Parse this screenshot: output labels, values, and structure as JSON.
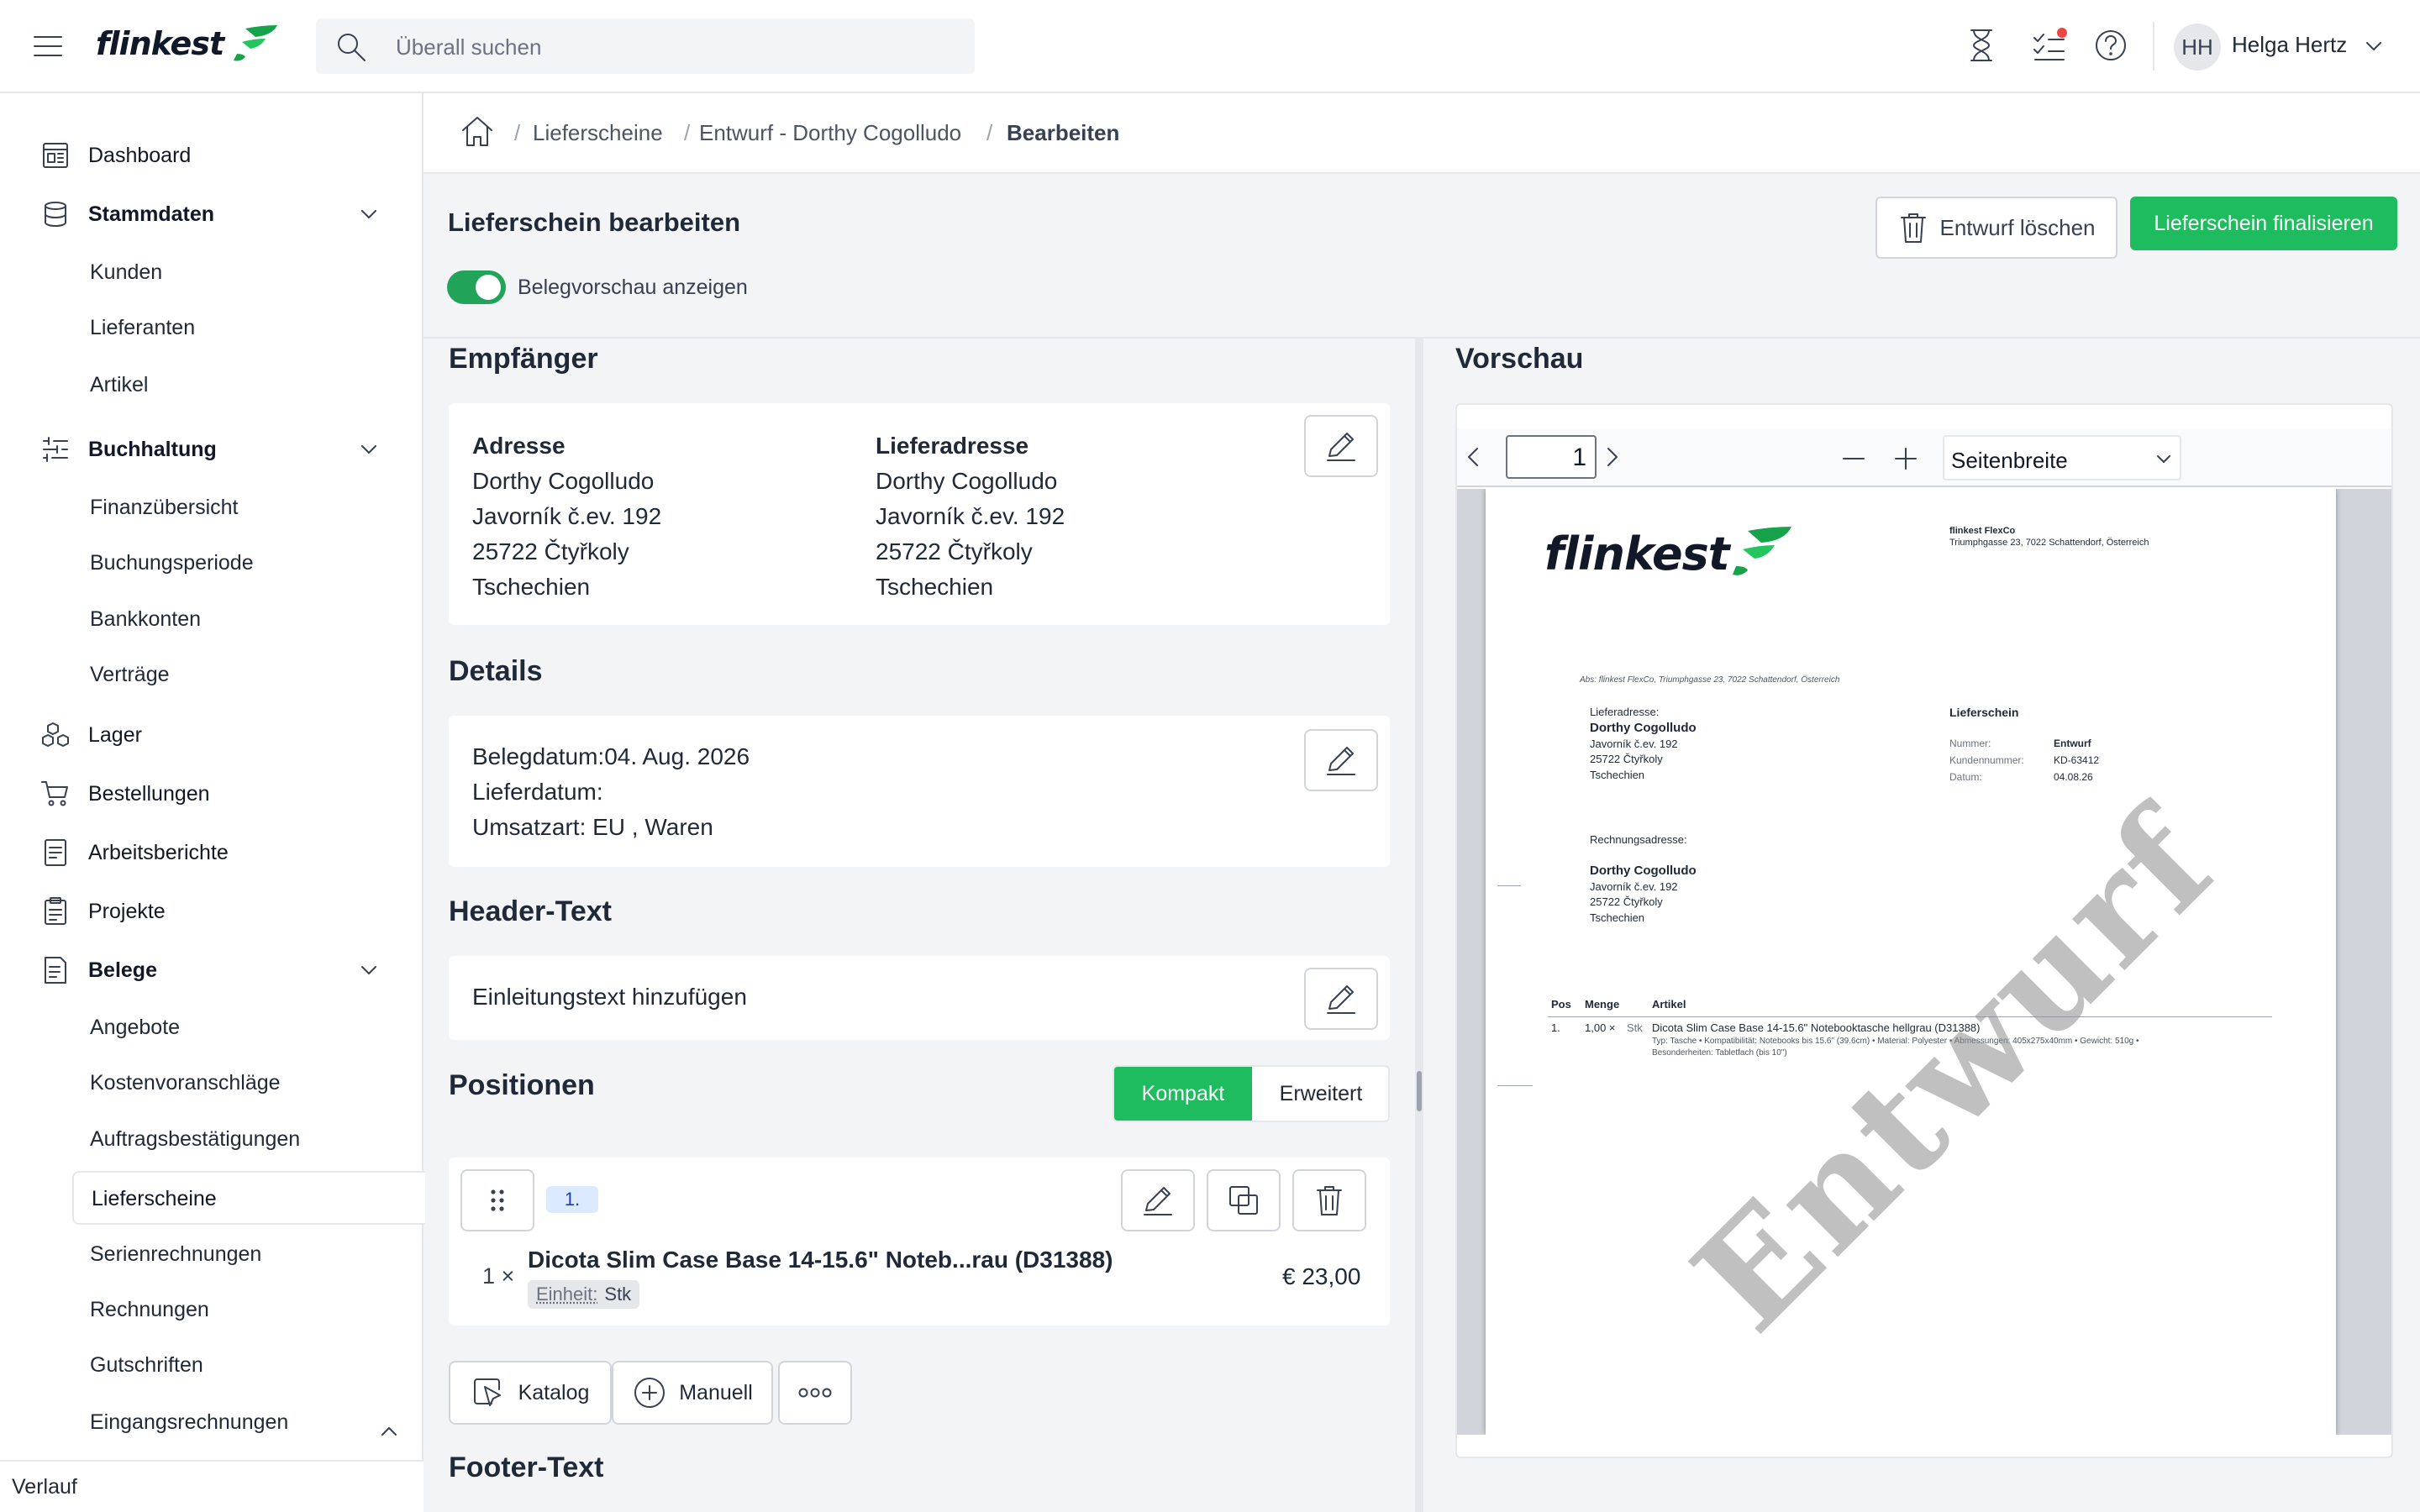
{
  "app": {
    "logo_text": "flinkest"
  },
  "search": {
    "placeholder": "Überall suchen"
  },
  "user": {
    "initials": "HH",
    "name": "Helga Hertz"
  },
  "sidebar": {
    "dashboard": "Dashboard",
    "stammdaten": "Stammdaten",
    "stammdaten_items": [
      "Kunden",
      "Lieferanten",
      "Artikel"
    ],
    "buchhaltung": "Buchhaltung",
    "buchhaltung_items": [
      "Finanzübersicht",
      "Buchungsperiode",
      "Bankkonten",
      "Verträge"
    ],
    "lager": "Lager",
    "bestellungen": "Bestellungen",
    "arbeitsberichte": "Arbeitsberichte",
    "projekte": "Projekte",
    "belege": "Belege",
    "belege_items": [
      "Angebote",
      "Kostenvoranschläge",
      "Auftragsbestätigungen",
      "Lieferscheine",
      "Serienrechnungen",
      "Rechnungen",
      "Gutschriften",
      "Eingangsrechnungen"
    ],
    "verlauf": "Verlauf"
  },
  "breadcrumb": [
    "Lieferscheine",
    "Entwurf - Dorthy Cogolludo",
    "Bearbeiten"
  ],
  "page": {
    "title": "Lieferschein bearbeiten",
    "preview_toggle_label": "Belegvorschau anzeigen",
    "delete_draft": "Entwurf löschen",
    "finalize": "Lieferschein finalisieren"
  },
  "recipient": {
    "section": "Empfänger",
    "address_title": "Adresse",
    "address": [
      "Dorthy Cogolludo",
      "Javorník č.ev. 192",
      "25722 Čtyřkoly",
      "Tschechien"
    ],
    "delivery_title": "Lieferadresse",
    "delivery": [
      "Dorthy Cogolludo",
      "Javorník č.ev. 192",
      "25722 Čtyřkoly",
      "Tschechien"
    ]
  },
  "details": {
    "section": "Details",
    "belegdatum": "Belegdatum:04. Aug. 2026",
    "lieferdatum": "Lieferdatum:",
    "umsatzart": "Umsatzart: EU , Waren"
  },
  "header_text": {
    "section": "Header-Text",
    "placeholder": "Einleitungstext hinzufügen"
  },
  "positions": {
    "section": "Positionen",
    "mode_compact": "Kompakt",
    "mode_extended": "Erweitert",
    "item": {
      "index": "1.",
      "qty": "1 ×",
      "name": "Dicota Slim Case Base 14-15.6\" Noteb...rau (D31388)",
      "unit_label": "Einheit:",
      "unit": "Stk",
      "price": "€ 23,00"
    },
    "btn_catalog": "Katalog",
    "btn_manual": "Manuell"
  },
  "footer_text": {
    "section": "Footer-Text"
  },
  "preview": {
    "section": "Vorschau",
    "page_number": "1",
    "zoom": "Seitenbreite",
    "doc": {
      "company_name": "flinkest FlexCo",
      "company_address": "Triumphgasse 23, 7022 Schattendorf, Österreich",
      "sender_line": "Abs: flinkest FlexCo, Triumphgasse 23, 7022 Schattendorf, Österreich",
      "delivery_label": "Lieferadresse:",
      "delivery_name": "Dorthy Cogolludo",
      "delivery_lines": [
        "Javorník č.ev. 192",
        "25722 Čtyřkoly",
        "Tschechien"
      ],
      "doc_title": "Lieferschein",
      "meta_labels": [
        "Nummer:",
        "Kundennummer:",
        "Datum:"
      ],
      "meta_values": [
        "Entwurf",
        "KD-63412",
        "04.08.26"
      ],
      "billing_label": "Rechnungsadresse:",
      "billing_name": "Dorthy Cogolludo",
      "billing_lines": [
        "Javorník č.ev. 192",
        "25722 Čtyřkoly",
        "Tschechien"
      ],
      "table_headers": [
        "Pos",
        "Menge",
        "Artikel"
      ],
      "row_pos": "1.",
      "row_qty": "1,00 ×",
      "row_unit": "Stk",
      "row_article": "Dicota Slim Case Base 14-15.6\" Notebooktasche hellgrau (D31388)",
      "row_desc1": "Typ: Tasche • Kompatibilität: Notebooks bis 15.6\" (39.6cm) • Material: Polyester • Abmessungen: 405x275x40mm • Gewicht: 510g •",
      "row_desc2": "Besonderheiten: Tabletfach (bis 10\")",
      "watermark": "Entwurf"
    }
  },
  "colors": {
    "brand_green": "#16a34a",
    "accent_green": "#22c55e",
    "notification_red": "#ef4444"
  }
}
